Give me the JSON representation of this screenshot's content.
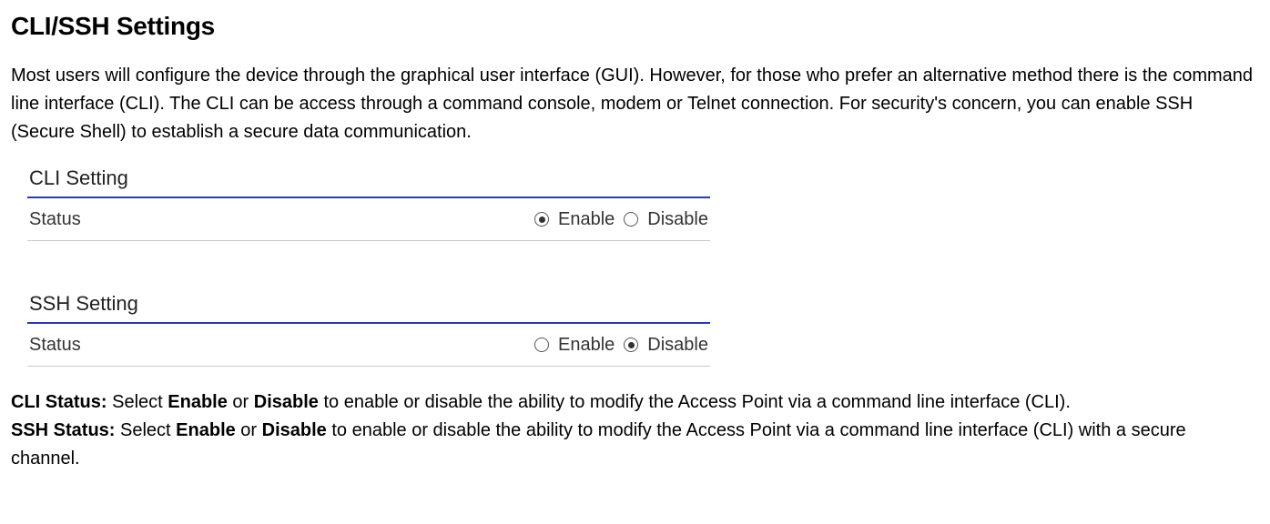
{
  "heading": "CLI/SSH Settings",
  "intro": "Most users will configure the device through the graphical user interface (GUI). However, for those who prefer an alternative method there is the command line interface (CLI). The CLI can be access through a command console, modem or Telnet connection. For security's concern, you can enable SSH (Secure Shell) to establish a secure data communication.",
  "cli": {
    "section_title": "CLI Setting",
    "status_label": "Status",
    "enable_label": "Enable",
    "disable_label": "Disable",
    "selected": "Enable"
  },
  "ssh": {
    "section_title": "SSH Setting",
    "status_label": "Status",
    "enable_label": "Enable",
    "disable_label": "Disable",
    "selected": "Disable"
  },
  "desc": {
    "cli_status_label": "CLI Status:",
    "cli_status_text_1": " Select ",
    "cli_enable": "Enable",
    "cli_or": " or ",
    "cli_disable": "Disable",
    "cli_status_text_2": " to enable or disable the ability to modify the Access Point via a command line interface (CLI).",
    "ssh_status_label": "SSH Status:",
    "ssh_status_text_1": " Select ",
    "ssh_enable": "Enable",
    "ssh_or": " or ",
    "ssh_disable": "Disable",
    "ssh_status_text_2": " to enable or disable the ability to modify the Access Point via a command line interface (CLI) with a secure channel."
  }
}
